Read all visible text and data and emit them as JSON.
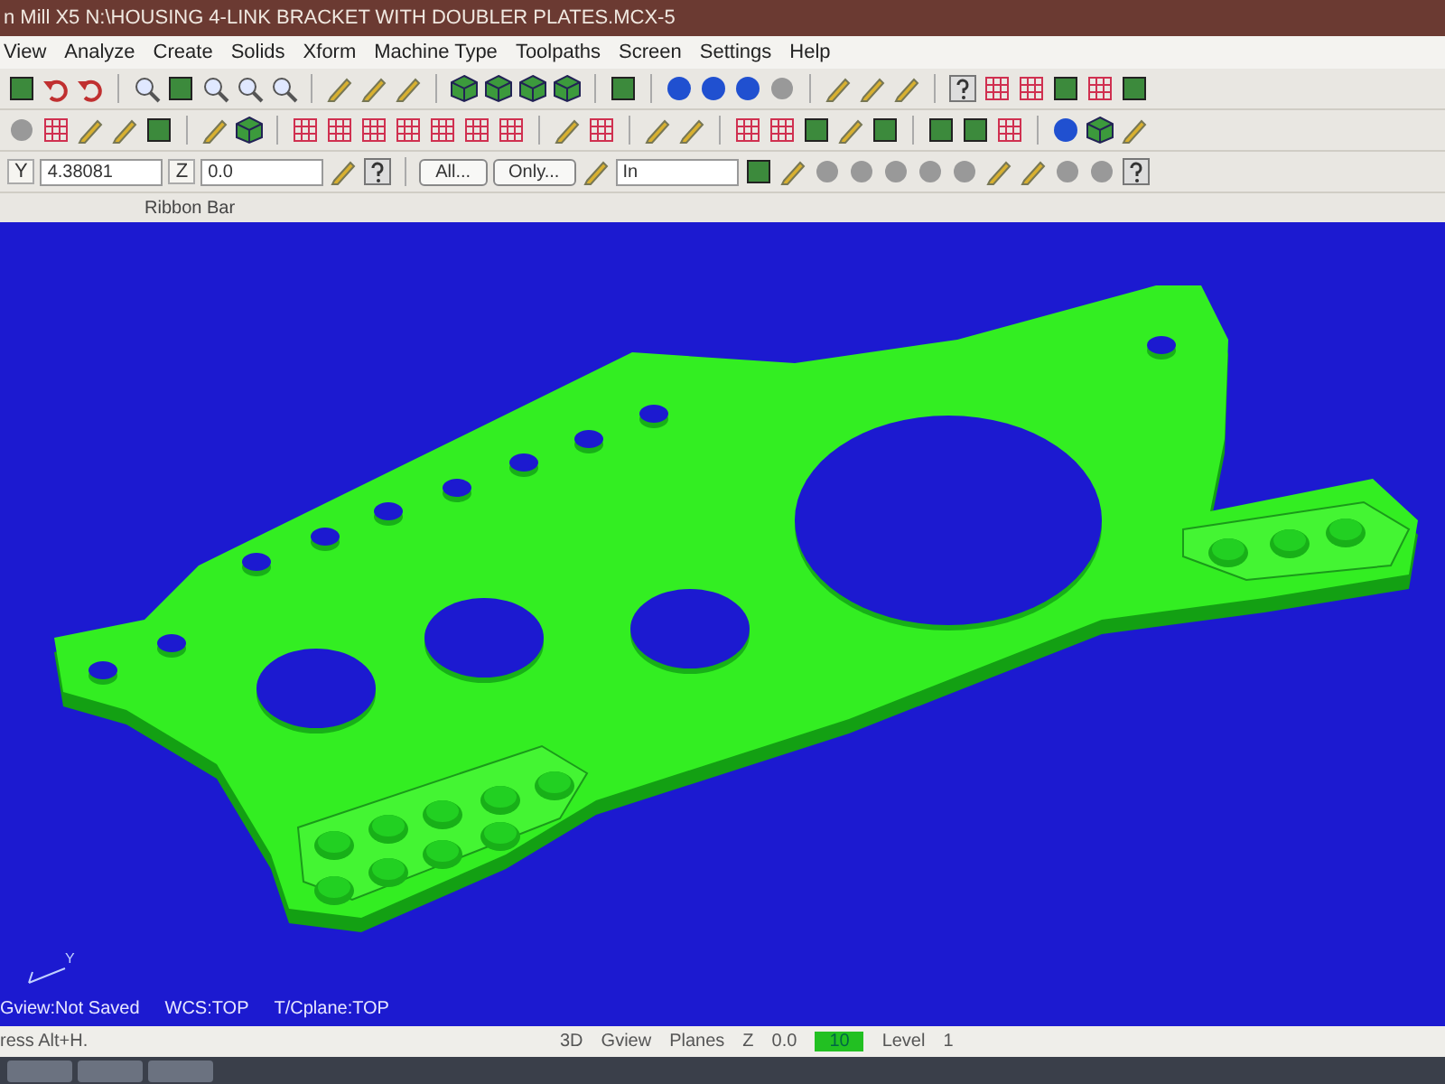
{
  "window": {
    "title": "n Mill X5  N:\\HOUSING 4-LINK BRACKET WITH DOUBLER PLATES.MCX-5"
  },
  "menu": [
    "View",
    "Analyze",
    "Create",
    "Solids",
    "Xform",
    "Machine Type",
    "Toolpaths",
    "Screen",
    "Settings",
    "Help"
  ],
  "ribbon": {
    "y_label": "Y",
    "y_value": "4.38081",
    "z_label": "Z",
    "z_value": "0.0",
    "buttons": [
      "All...",
      "Only..."
    ],
    "mode": "In",
    "label": "Ribbon Bar"
  },
  "viewport": {
    "gview": "Gview:Not Saved",
    "wcs": "WCS:TOP",
    "cplane": "T/Cplane:TOP",
    "axis_label": "Y"
  },
  "status_bar": {
    "hint": "ress Alt+H.",
    "items": [
      "3D",
      "Gview",
      "Planes"
    ],
    "z_label": "Z",
    "z_value": "0.0",
    "color_value": "10",
    "level_label": "Level",
    "level_value": "1"
  }
}
